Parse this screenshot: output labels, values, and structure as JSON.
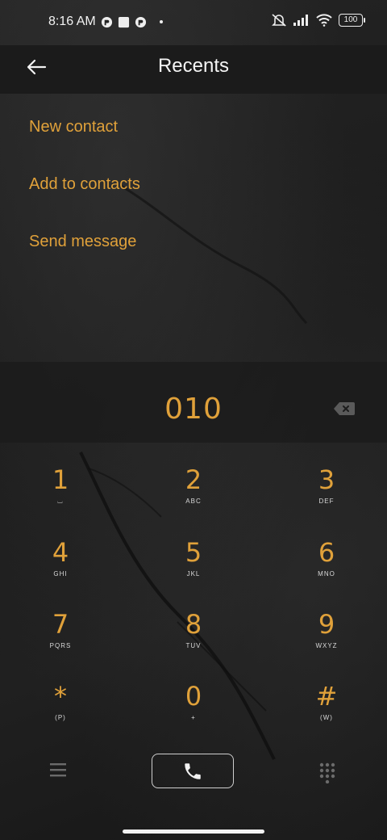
{
  "status_bar": {
    "time": "8:16 AM",
    "battery": "100",
    "icons": [
      "notification-app-icon",
      "notification-square-icon",
      "notification-app-icon-2",
      "dot-icon",
      "mute-icon",
      "signal-icon",
      "wifi-icon",
      "battery-icon"
    ]
  },
  "header": {
    "title": "Recents",
    "back_icon": "arrow-left-icon"
  },
  "options": [
    {
      "label": "New contact"
    },
    {
      "label": "Add to contacts"
    },
    {
      "label": "Send message"
    }
  ],
  "dialer": {
    "number": "010",
    "backspace_icon": "backspace-icon"
  },
  "keypad": [
    {
      "digit": "1",
      "letters": "⌴"
    },
    {
      "digit": "2",
      "letters": "ABC"
    },
    {
      "digit": "3",
      "letters": "DEF"
    },
    {
      "digit": "4",
      "letters": "GHI"
    },
    {
      "digit": "5",
      "letters": "JKL"
    },
    {
      "digit": "6",
      "letters": "MNO"
    },
    {
      "digit": "7",
      "letters": "PQRS"
    },
    {
      "digit": "8",
      "letters": "TUV"
    },
    {
      "digit": "9",
      "letters": "WXYZ"
    },
    {
      "digit": "*",
      "letters": "(P)"
    },
    {
      "digit": "0",
      "letters": "+"
    },
    {
      "digit": "#",
      "letters": "(W)"
    }
  ],
  "bottom_bar": {
    "menu_icon": "menu-icon",
    "call_icon": "phone-icon",
    "dialpad_icon": "dialpad-icon"
  },
  "colors": {
    "accent": "#e0a13a",
    "background": "#1e1e1e"
  }
}
